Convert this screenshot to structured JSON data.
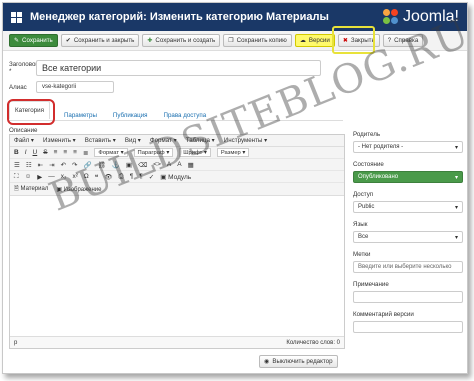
{
  "header": {
    "title": "Менеджер категорий: Изменить категорию Материалы",
    "logo_text": "Joomla!"
  },
  "toolbar": {
    "save": "Сохранить",
    "save_close": "Сохранить и закрыть",
    "save_new": "Сохранить и создать",
    "save_copy": "Сохранить копию",
    "versions": "Версии",
    "close": "Закрыть",
    "help": "Справка"
  },
  "form": {
    "title_label": "Заголовок *",
    "title_value": "Все категории",
    "alias_label": "Алиас",
    "alias_value": "vse-kategorii"
  },
  "tabs": [
    "Категория",
    "Параметры",
    "Публикация",
    "Права доступа"
  ],
  "editor": {
    "description_label": "Описание",
    "menu": [
      "Файл ▾",
      "Изменить ▾",
      "Вставить ▾",
      "Вид ▾",
      "Формат ▾",
      "Таблица ▾",
      "Инструменты ▾"
    ],
    "format_select": "Формат",
    "paragraph_select": "Параграф",
    "font_select": "Шрифт",
    "size_select": "Размер",
    "module_button": "Модуль",
    "article_button": "Материал",
    "image_button": "Изображение",
    "path": "p",
    "word_count": "Количество слов: 0",
    "toggle_editor": "Выключить редактор"
  },
  "sidebar": {
    "parent_label": "Родитель",
    "parent_value": "- Нет родителя -",
    "state_label": "Состояние",
    "state_value": "Опубликовано",
    "access_label": "Доступ",
    "access_value": "Public",
    "language_label": "Язык",
    "language_value": "Все",
    "tags_label": "Метки",
    "tags_placeholder": "Введите или выберите несколько",
    "note_label": "Примечание",
    "version_note_label": "Комментарий версии"
  },
  "watermark": "BUILDSITEBLOG.RU",
  "colors": {
    "header_bg": "#1a3867",
    "save_green": "#3c8b3c",
    "version_yellow": "#fffa6b",
    "highlight_red": "#d22d2d",
    "highlight_yellow": "#e8e23a",
    "published_green": "#4a9a4a"
  }
}
